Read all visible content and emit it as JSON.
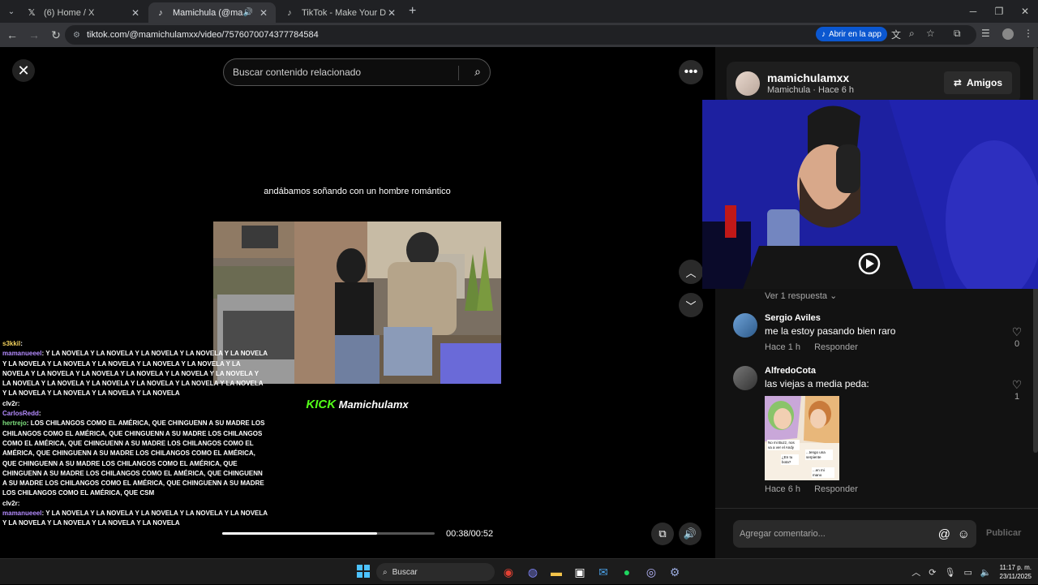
{
  "browser": {
    "tabs": [
      {
        "title": "(6) Home / X",
        "favicon": "x-logo-icon",
        "active": false
      },
      {
        "title": "Mamichula (@mamichulam",
        "favicon": "tiktok-logo-icon",
        "active": true
      },
      {
        "title": "TikTok - Make Your Day",
        "favicon": "tiktok-logo-icon",
        "active": false
      }
    ],
    "url": "tiktok.com/@mamichulamxx/video/7576070074377784584",
    "open_app_label": "Abrir en la app"
  },
  "video": {
    "search_placeholder": "Buscar contenido relacionado",
    "caption": "andábamos soñando con un hombre romántico",
    "brand_kick": "KICK",
    "brand_name": "Mamichulamx",
    "progress": 0.73,
    "time": "00:38/00:52"
  },
  "chat": [
    {
      "user": "s3kkil",
      "user_color": "#f4d35e",
      "text": ""
    },
    {
      "user": "mamanueeel",
      "user_color": "#b58cff",
      "text": "Y LA NOVELA Y LA NOVELA Y LA NOVELA Y LA NOVELA Y LA NOVELA Y LA NOVELA Y LA NOVELA Y LA NOVELA Y LA NOVELA Y LA NOVELA Y LA NOVELA Y LA NOVELA Y LA NOVELA Y LA NOVELA Y LA NOVELA Y LA NOVELA Y LA NOVELA Y LA NOVELA Y LA NOVELA Y LA NOVELA Y LA NOVELA Y LA NOVELA Y LA NOVELA Y LA NOVELA Y LA NOVELA Y LA NOVELA"
    },
    {
      "user": "clv2r",
      "user_color": "#ffffff",
      "text": ""
    },
    {
      "user": "CarlosRedd",
      "user_color": "#b58cff",
      "text": ""
    },
    {
      "user": "hertrejo",
      "user_color": "#7ee07e",
      "text": "LOS CHILANGOS COMO EL AMÉRICA, QUE CHINGUENN A SU MADRE LOS CHILANGOS COMO EL AMÉRICA, QUE CHINGUENN A SU MADRE LOS CHILANGOS COMO EL AMÉRICA, QUE CHINGUENN A SU MADRE LOS CHILANGOS COMO EL AMÉRICA, QUE CHINGUENN A SU MADRE LOS CHILANGOS COMO EL AMÉRICA, QUE CHINGUENN A SU MADRE LOS CHILANGOS COMO EL AMÉRICA, QUE CHINGUENN A SU MADRE LOS CHILANGOS COMO EL AMÉRICA, QUE CHINGUENN A SU MADRE LOS CHILANGOS COMO EL AMÉRICA, QUE CHINGUENN A SU MADRE LOS CHILANGOS COMO EL AMÉRICA, QUE CSM"
    },
    {
      "user": "clv2r",
      "user_color": "#ffffff",
      "text": ""
    },
    {
      "user": "mamanueeel",
      "user_color": "#b58cff",
      "text": "Y LA NOVELA Y LA NOVELA Y LA NOVELA Y LA NOVELA Y LA NOVELA Y LA NOVELA Y LA NOVELA Y LA NOVELA Y LA NOVELA"
    }
  ],
  "author": {
    "username": "mamichulamxx",
    "subtitle": "Mamichula · Hace 6 h",
    "friends_label": "Amigos"
  },
  "comments": {
    "view_replies": "Ver 1 respuesta",
    "items": [
      {
        "name": "Sergio Aviles",
        "text": "me la estoy pasando bien raro",
        "time": "Hace 1 h",
        "reply": "Responder",
        "likes": "0"
      },
      {
        "name": "AlfredoCota",
        "text": "las viejas a media peda:",
        "time": "Hace 6 h",
        "reply": "Responder",
        "likes": "1"
      }
    ],
    "meme_text": [
      "No mi Buzz, nos va a ver el Andy",
      "¿En tu bota?",
      "...tengo una serpiente",
      "...en mi mano"
    ],
    "input_placeholder": "Agregar comentario...",
    "publish_label": "Publicar"
  },
  "taskbar": {
    "search_label": "Buscar",
    "time": "11:17 p. m.",
    "date": "23/11/2025"
  }
}
